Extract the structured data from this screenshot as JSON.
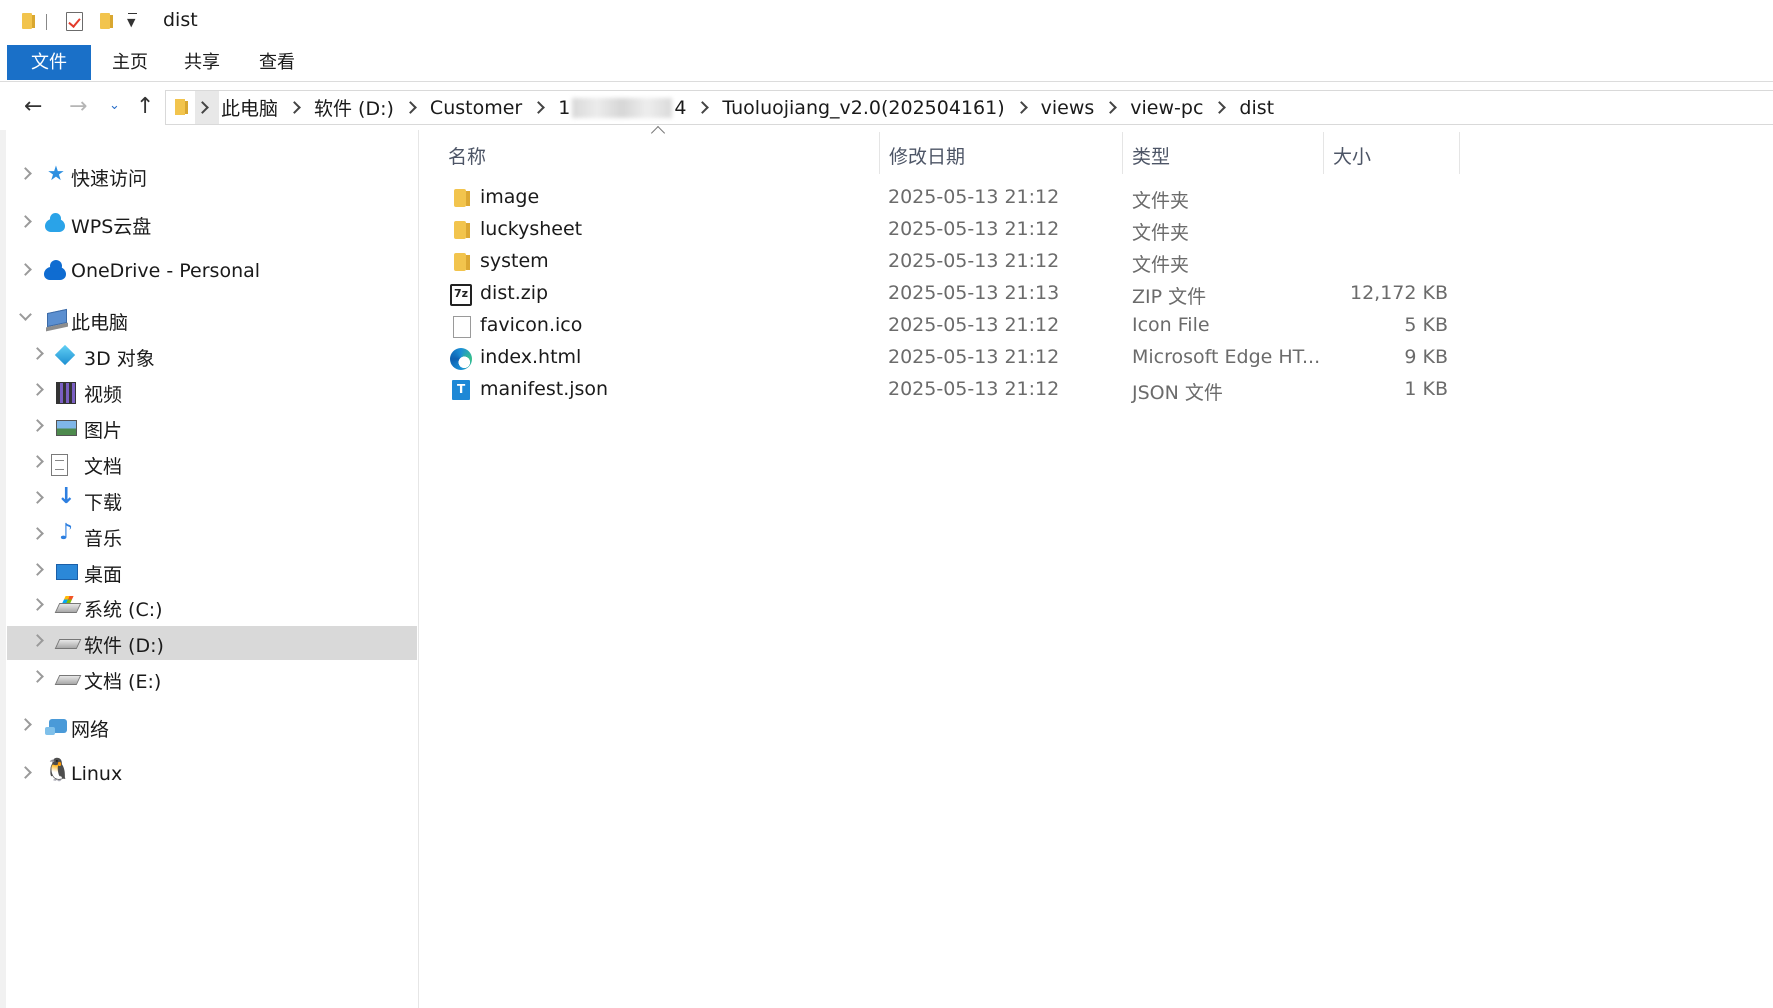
{
  "window": {
    "title": "dist"
  },
  "ribbon": {
    "tabs": [
      {
        "label": "文件",
        "active": true
      },
      {
        "label": "主页"
      },
      {
        "label": "共享"
      },
      {
        "label": "查看"
      }
    ]
  },
  "address": {
    "crumbs": [
      "此电脑",
      "软件 (D:)",
      "Customer",
      "1",
      "4",
      "Tuoluojiang_v2.0(202504161)",
      "views",
      "view-pc",
      "dist"
    ]
  },
  "nav": {
    "items": [
      {
        "label": "快速访问",
        "icon": "star-icon"
      },
      {
        "label": "WPS云盘",
        "icon": "wps-cloud-icon"
      },
      {
        "label": "OneDrive - Personal",
        "icon": "onedrive-icon"
      },
      {
        "label": "此电脑",
        "icon": "this-pc-icon"
      },
      {
        "label": "3D 对象",
        "icon": "3d-objects-icon"
      },
      {
        "label": "视频",
        "icon": "video-icon"
      },
      {
        "label": "图片",
        "icon": "pictures-icon"
      },
      {
        "label": "文档",
        "icon": "documents-icon"
      },
      {
        "label": "下载",
        "icon": "downloads-icon"
      },
      {
        "label": "音乐",
        "icon": "music-icon"
      },
      {
        "label": "桌面",
        "icon": "desktop-icon"
      },
      {
        "label": "系统 (C:)",
        "icon": "drive-c-icon"
      },
      {
        "label": "软件 (D:)",
        "icon": "drive-d-icon",
        "selected": true
      },
      {
        "label": "文档 (E:)",
        "icon": "drive-e-icon"
      },
      {
        "label": "网络",
        "icon": "network-icon"
      },
      {
        "label": "Linux",
        "icon": "linux-icon"
      }
    ]
  },
  "columns": {
    "name": "名称",
    "date": "修改日期",
    "type": "类型",
    "size": "大小"
  },
  "files": [
    {
      "name": "image",
      "date": "2025-05-13 21:12",
      "type": "文件夹",
      "size": "",
      "icon": "folder-icon"
    },
    {
      "name": "luckysheet",
      "date": "2025-05-13 21:12",
      "type": "文件夹",
      "size": "",
      "icon": "folder-icon"
    },
    {
      "name": "system",
      "date": "2025-05-13 21:12",
      "type": "文件夹",
      "size": "",
      "icon": "folder-icon"
    },
    {
      "name": "dist.zip",
      "date": "2025-05-13 21:13",
      "type": "ZIP 文件",
      "size": "12,172 KB",
      "icon": "7zip-archive-icon"
    },
    {
      "name": "favicon.ico",
      "date": "2025-05-13 21:12",
      "type": "Icon File",
      "size": "5 KB",
      "icon": "blank-file-icon"
    },
    {
      "name": "index.html",
      "date": "2025-05-13 21:12",
      "type": "Microsoft Edge HT...",
      "size": "9 KB",
      "icon": "edge-icon"
    },
    {
      "name": "manifest.json",
      "date": "2025-05-13 21:12",
      "type": "JSON 文件",
      "size": "1 KB",
      "icon": "json-file-icon"
    }
  ]
}
